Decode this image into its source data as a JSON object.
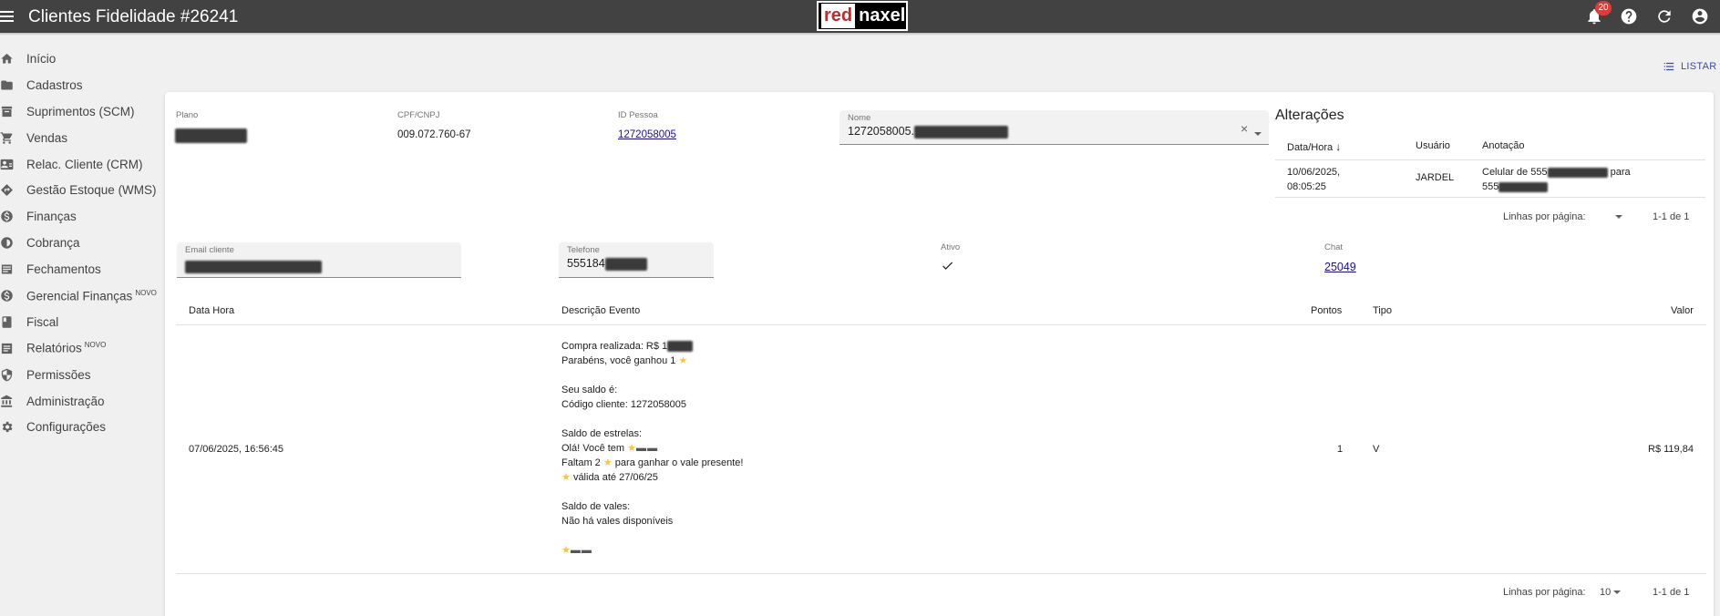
{
  "header": {
    "title": "Clientes Fidelidade #26241",
    "logo": {
      "part1": "red",
      "part2": "naxel"
    },
    "notifications_count": "20"
  },
  "sidebar": {
    "items": [
      {
        "label": "Início",
        "icon": "home-icon",
        "new": ""
      },
      {
        "label": "Cadastros",
        "icon": "folder-icon",
        "new": ""
      },
      {
        "label": "Suprimentos (SCM)",
        "icon": "box-icon",
        "new": ""
      },
      {
        "label": "Vendas",
        "icon": "cart-icon",
        "new": ""
      },
      {
        "label": "Relac. Cliente (CRM)",
        "icon": "contact-card-icon",
        "new": ""
      },
      {
        "label": "Gestão Estoque (WMS)",
        "icon": "diamond-icon",
        "new": ""
      },
      {
        "label": "Finanças",
        "icon": "dollar-icon",
        "new": ""
      },
      {
        "label": "Cobrança",
        "icon": "coin-icon",
        "new": ""
      },
      {
        "label": "Fechamentos",
        "icon": "list-icon",
        "new": ""
      },
      {
        "label": "Gerencial Finanças",
        "icon": "dollar-circle-icon",
        "new": "NOVO"
      },
      {
        "label": "Fiscal",
        "icon": "book-icon",
        "new": ""
      },
      {
        "label": "Relatórios",
        "icon": "report-icon",
        "new": "NOVO"
      },
      {
        "label": "Permissões",
        "icon": "shield-icon",
        "new": ""
      },
      {
        "label": "Administração",
        "icon": "bank-icon",
        "new": ""
      },
      {
        "label": "Configurações",
        "icon": "gear-icon",
        "new": ""
      }
    ]
  },
  "toolbar": {
    "listar_label": "LISTAR"
  },
  "form": {
    "plano_label": "Plano",
    "cpf_label": "CPF/CNPJ",
    "cpf_value": "009.072.760-67",
    "id_pessoa_label": "ID Pessoa",
    "id_pessoa_value": "1272058005",
    "nome_label": "Nome",
    "nome_value": "1272058005.",
    "email_label": "Email cliente",
    "telefone_label": "Telefone",
    "telefone_value": "555184",
    "ativo_label": "Ativo",
    "chat_label": "Chat",
    "chat_value": "25049"
  },
  "alteracoes": {
    "title": "Alterações",
    "columns": [
      "Data/Hora",
      "Usuário",
      "Anotação"
    ],
    "rows": [
      {
        "data_line1": "10/06/2025,",
        "data_line2": "08:05:25",
        "usuario": "JARDEL",
        "anotacao_line1": "Celular de 555",
        "anotacao_mid": "para",
        "anotacao_line2": "555"
      }
    ],
    "pager": {
      "rows_label": "Linhas por página:",
      "range": "1-1 de 1"
    }
  },
  "events": {
    "columns": [
      "Data Hora",
      "Descrição Evento",
      "Pontos",
      "Tipo",
      "Valor"
    ],
    "rows": [
      {
        "data_hora": "07/06/2025, 16:56:45",
        "compra": "Compra realizada: R$ 1",
        "parabens": "Parabéns, você ganhou 1",
        "seu_saldo": "Seu saldo é:",
        "codigo": "Código cliente: 1272058005",
        "saldo_estrelas": "Saldo de estrelas:",
        "ola": "Olá! Você tem",
        "faltam_a": "Faltam 2",
        "faltam_b": "para ganhar o vale presente!",
        "valida": "válida até 27/06/25",
        "saldo_vales": "Saldo de vales:",
        "nao_ha": "Não há vales disponíveis",
        "pontos": "1",
        "tipo": "V",
        "valor": "R$ 119,84"
      }
    ],
    "pager": {
      "rows_label": "Linhas por página:",
      "per_page": "10",
      "range": "1-1 de 1"
    }
  },
  "colors": {
    "topbar": "#424242",
    "accent": "#3949ab",
    "link": "#1a0dab",
    "badge": "#e53935"
  }
}
